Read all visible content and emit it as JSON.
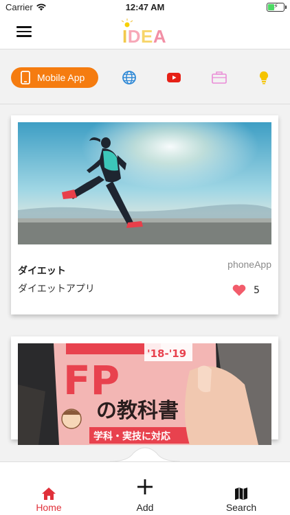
{
  "status_bar": {
    "carrier": "Carrier",
    "time": "12:47 AM",
    "battery_charging": true
  },
  "header": {
    "logo_text": "IDEA",
    "menu_icon": "hamburger-menu-icon"
  },
  "categories": [
    {
      "label": "Mobile App",
      "icon": "smartphone-icon",
      "selected": true,
      "color": "#f57c10"
    },
    {
      "label": "",
      "icon": "globe-icon",
      "color": "#2f89d6"
    },
    {
      "label": "",
      "icon": "youtube-icon",
      "color": "#e62117"
    },
    {
      "label": "",
      "icon": "briefcase-icon",
      "color": "#e98ad6"
    },
    {
      "label": "",
      "icon": "lightbulb-icon",
      "color": "#f5c400"
    }
  ],
  "posts": [
    {
      "title": "ダイエット",
      "description": "ダイエットアプリ",
      "category": "phoneApp",
      "likes": "5",
      "image": "runner-photo"
    },
    {
      "title": "",
      "description": "",
      "category": "",
      "likes": "",
      "image": "fp-textbook-photo"
    }
  ],
  "textbook_photo_text": {
    "headline": "FP",
    "subtitle": "の教科書",
    "years": "'18-'19",
    "banner": "学科・実技に対応"
  },
  "tabbar": {
    "tabs": [
      {
        "label": "Home",
        "icon": "home-icon",
        "active": true
      },
      {
        "label": "Add",
        "icon": "plus-icon",
        "active": false
      },
      {
        "label": "Search",
        "icon": "map-icon",
        "active": false
      }
    ]
  },
  "colors": {
    "accent": "#f57c10",
    "active_tab": "#e0303a",
    "heart": "#f25c6b"
  }
}
